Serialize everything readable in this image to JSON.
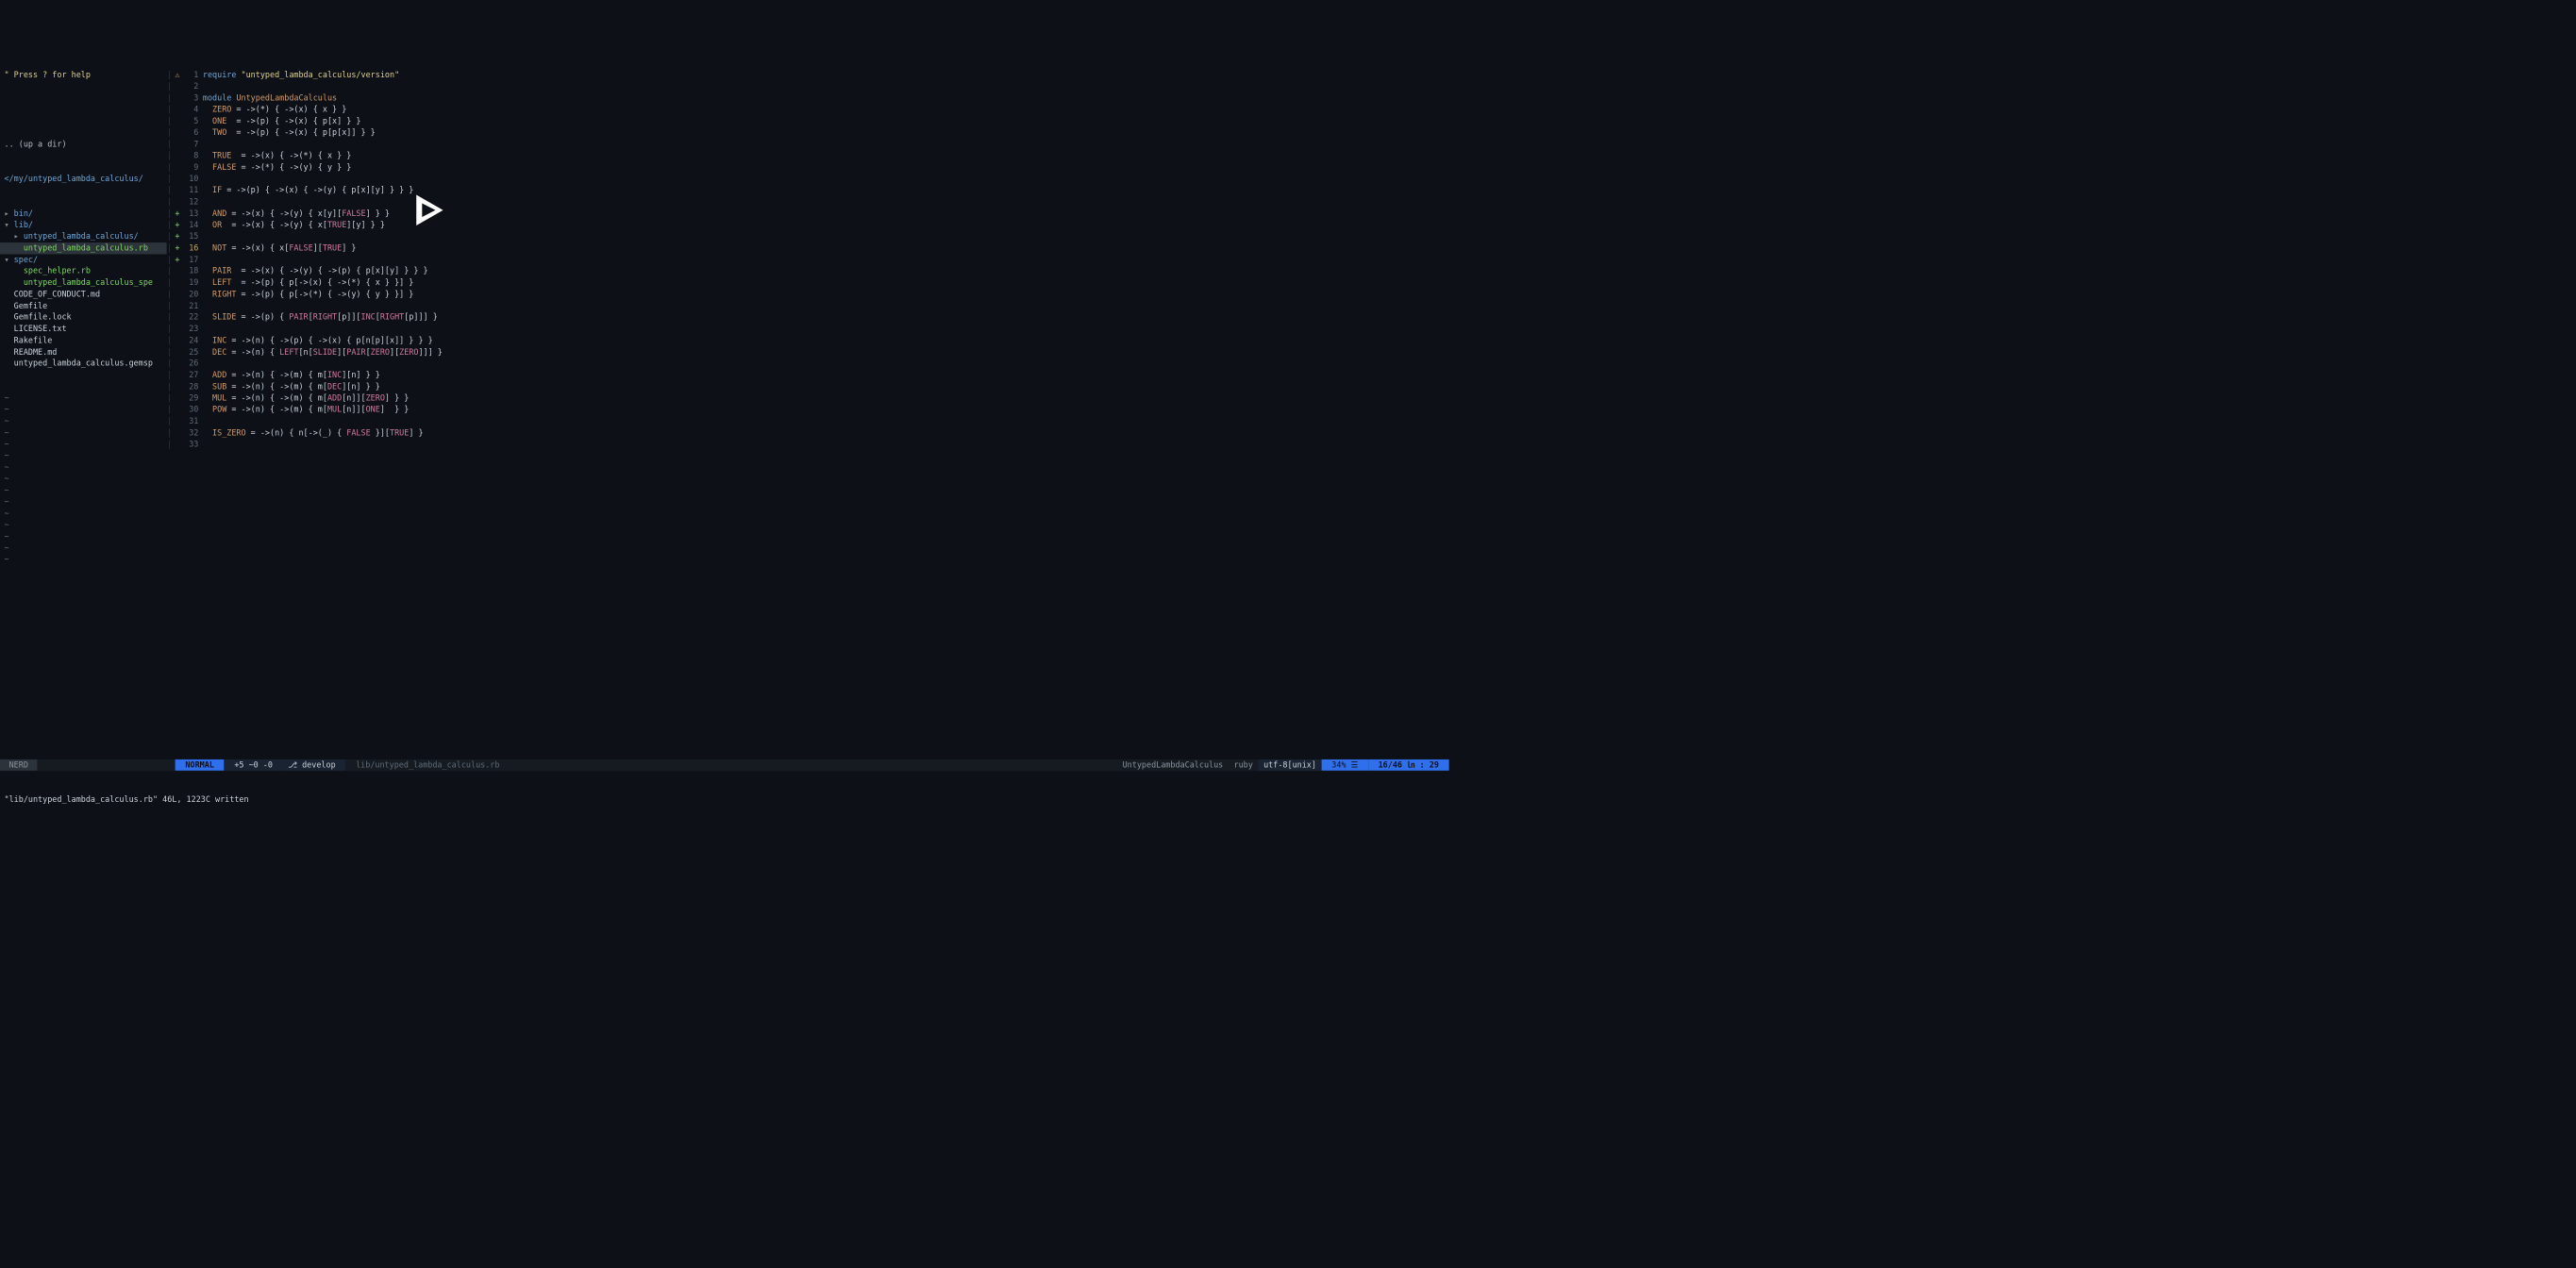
{
  "sidebar": {
    "help": "\" Press ? for help",
    "up": ".. (up a dir)",
    "path": "</my/untyped_lambda_calculus/",
    "tree": [
      {
        "indent": 0,
        "arrow": "▸",
        "label": "bin/",
        "cls": "dir"
      },
      {
        "indent": 0,
        "arrow": "▾",
        "label": "lib/",
        "cls": "dir"
      },
      {
        "indent": 1,
        "arrow": "▸",
        "label": "untyped_lambda_calculus/",
        "cls": "dir"
      },
      {
        "indent": 1,
        "arrow": " ",
        "label": "untyped_lambda_calculus.rb",
        "cls": "rb selected"
      },
      {
        "indent": 0,
        "arrow": "▾",
        "label": "spec/",
        "cls": "dir"
      },
      {
        "indent": 1,
        "arrow": " ",
        "label": "spec_helper.rb",
        "cls": "rb"
      },
      {
        "indent": 1,
        "arrow": " ",
        "label": "untyped_lambda_calculus_spe",
        "cls": "rb"
      },
      {
        "indent": 0,
        "arrow": " ",
        "label": "CODE_OF_CONDUCT.md",
        "cls": ""
      },
      {
        "indent": 0,
        "arrow": " ",
        "label": "Gemfile",
        "cls": ""
      },
      {
        "indent": 0,
        "arrow": " ",
        "label": "Gemfile.lock",
        "cls": ""
      },
      {
        "indent": 0,
        "arrow": " ",
        "label": "LICENSE.txt",
        "cls": ""
      },
      {
        "indent": 0,
        "arrow": " ",
        "label": "Rakefile",
        "cls": ""
      },
      {
        "indent": 0,
        "arrow": " ",
        "label": "README.md",
        "cls": ""
      },
      {
        "indent": 0,
        "arrow": " ",
        "label": "untyped_lambda_calculus.gemsp",
        "cls": ""
      }
    ],
    "tildes": 15
  },
  "code": {
    "lines": [
      {
        "n": 1,
        "sign": "⚠",
        "html": "<span class='kw'>require</span> <span class='str'>\"untyped_lambda_calculus/version\"</span>"
      },
      {
        "n": 2,
        "sign": "",
        "html": ""
      },
      {
        "n": 3,
        "sign": "",
        "html": "<span class='kw'>module</span> <span class='const'>UntypedLambdaCalculus</span>"
      },
      {
        "n": 4,
        "sign": "",
        "html": "  <span class='const'>ZERO</span> = -&gt;(*) { -&gt;(x) { x } }"
      },
      {
        "n": 5,
        "sign": "",
        "html": "  <span class='const'>ONE</span>  = -&gt;(p) { -&gt;(x) { p[x] } }"
      },
      {
        "n": 6,
        "sign": "",
        "html": "  <span class='const'>TWO</span>  = -&gt;(p) { -&gt;(x) { p[p[x]] } }"
      },
      {
        "n": 7,
        "sign": "",
        "html": ""
      },
      {
        "n": 8,
        "sign": "",
        "html": "  <span class='const'>TRUE</span>  = -&gt;(x) { -&gt;(*) { x } }"
      },
      {
        "n": 9,
        "sign": "",
        "html": "  <span class='const'>FALSE</span> = -&gt;(*) { -&gt;(y) { y } }"
      },
      {
        "n": 10,
        "sign": "",
        "html": ""
      },
      {
        "n": 11,
        "sign": "",
        "html": "  <span class='const'>IF</span> = -&gt;(p) { -&gt;(x) { -&gt;(y) { p[x][y] } } }"
      },
      {
        "n": 12,
        "sign": "",
        "html": ""
      },
      {
        "n": 13,
        "sign": "+",
        "html": "  <span class='const'>AND</span> = -&gt;(x) { -&gt;(y) { x[y][<span class='constref'>FALSE</span>] } }"
      },
      {
        "n": 14,
        "sign": "+",
        "html": "  <span class='const'>OR</span>  = -&gt;(x) { -&gt;(y) { x[<span class='constref'>TRUE</span>][y] } }"
      },
      {
        "n": 15,
        "sign": "+",
        "html": ""
      },
      {
        "n": 16,
        "sign": "+",
        "html": "  <span class='const'>NOT</span> = -&gt;(x) { x[<span class='constref'>FALSE</span>][<span class='constref'>TRUE</span>] }",
        "current": true
      },
      {
        "n": 17,
        "sign": "+",
        "html": ""
      },
      {
        "n": 18,
        "sign": "",
        "html": "  <span class='const'>PAIR</span>  = -&gt;(x) { -&gt;(y) { -&gt;(p) { p[x][y] } } }"
      },
      {
        "n": 19,
        "sign": "",
        "html": "  <span class='const'>LEFT</span>  = -&gt;(p) { p[-&gt;(x) { -&gt;(*) { x } }] }"
      },
      {
        "n": 20,
        "sign": "",
        "html": "  <span class='const'>RIGHT</span> = -&gt;(p) { p[-&gt;(*) { -&gt;(y) { y } }] }"
      },
      {
        "n": 21,
        "sign": "",
        "html": ""
      },
      {
        "n": 22,
        "sign": "",
        "html": "  <span class='const'>SLIDE</span> = -&gt;(p) { <span class='constref'>PAIR</span>[<span class='constref'>RIGHT</span>[p]][<span class='constref'>INC</span>[<span class='constref'>RIGHT</span>[p]]] }"
      },
      {
        "n": 23,
        "sign": "",
        "html": ""
      },
      {
        "n": 24,
        "sign": "",
        "html": "  <span class='const'>INC</span> = -&gt;(n) { -&gt;(p) { -&gt;(x) { p[n[p][x]] } } }"
      },
      {
        "n": 25,
        "sign": "",
        "html": "  <span class='const'>DEC</span> = -&gt;(n) { <span class='constref'>LEFT</span>[n[<span class='constref'>SLIDE</span>][<span class='constref'>PAIR</span>[<span class='constref'>ZERO</span>][<span class='constref'>ZERO</span>]]] }"
      },
      {
        "n": 26,
        "sign": "",
        "html": ""
      },
      {
        "n": 27,
        "sign": "",
        "html": "  <span class='const'>ADD</span> = -&gt;(n) { -&gt;(m) { m[<span class='constref'>INC</span>][n] } }"
      },
      {
        "n": 28,
        "sign": "",
        "html": "  <span class='const'>SUB</span> = -&gt;(n) { -&gt;(m) { m[<span class='constref'>DEC</span>][n] } }"
      },
      {
        "n": 29,
        "sign": "",
        "html": "  <span class='const'>MUL</span> = -&gt;(n) { -&gt;(m) { m[<span class='constref'>ADD</span>[n]][<span class='constref'>ZERO</span>] } }"
      },
      {
        "n": 30,
        "sign": "",
        "html": "  <span class='const'>POW</span> = -&gt;(n) { -&gt;(m) { m[<span class='constref'>MUL</span>[n]][<span class='constref'>ONE</span>]  } }"
      },
      {
        "n": 31,
        "sign": "",
        "html": ""
      },
      {
        "n": 32,
        "sign": "",
        "html": "  <span class='const'>IS_ZERO</span> = -&gt;(n) { n[-&gt;(_) { <span class='constref'>FALSE</span> }][<span class='constref'>TRUE</span>] }"
      },
      {
        "n": 33,
        "sign": "",
        "html": ""
      }
    ]
  },
  "status": {
    "nerd": " NERD ",
    "mode": " NORMAL ",
    "diff": " +5 ~0 -0 ",
    "branch_icon": "⎇",
    "branch": " develop ",
    "file": " lib/untyped_lambda_calculus.rb ",
    "class": "UntypedLambdaCalculus",
    "ft": "ruby",
    "enc": "utf-8[unix]",
    "pct": " 34% ☰ ",
    "pos": " 16/46 ㏑ : 29 "
  },
  "message": "\"lib/untyped_lambda_calculus.rb\" 46L, 1223C written"
}
